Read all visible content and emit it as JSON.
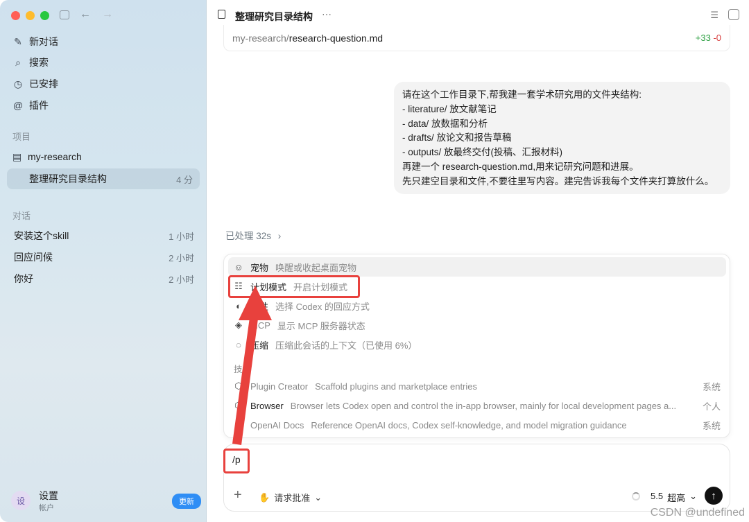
{
  "sidebar": {
    "top_icons": [
      "sidebar-toggle-icon",
      "back-arrow-icon",
      "forward-arrow-icon"
    ],
    "back_glyph": "←",
    "forward_glyph": "→",
    "nav": [
      {
        "icon": "compose-icon",
        "glyph": "✎",
        "label": "新对话"
      },
      {
        "icon": "search-icon",
        "glyph": "⌕",
        "label": "搜索"
      },
      {
        "icon": "clock-icon",
        "glyph": "◷",
        "label": "已安排"
      },
      {
        "icon": "plugin-icon",
        "glyph": "@",
        "label": "插件"
      }
    ],
    "projects_label": "项目",
    "project": {
      "icon": "folder-icon",
      "glyph": "▤",
      "label": "my-research"
    },
    "active_task": {
      "label": "整理研究目录结构",
      "meta": "4 分"
    },
    "conversations_label": "对话",
    "conversations": [
      {
        "label": "安装这个skill",
        "meta": "1 小时"
      },
      {
        "label": "回应问候",
        "meta": "2 小时"
      },
      {
        "label": "你好",
        "meta": "2 小时"
      }
    ],
    "user": {
      "avatar": "设",
      "name": "设置",
      "sub": "帐户",
      "update_label": "更新"
    }
  },
  "header": {
    "title": "整理研究目录结构",
    "more_glyph": "···",
    "list_glyph": "☰"
  },
  "file_card": {
    "dir": "my-research/",
    "file": "research-question.md",
    "added": "+33",
    "removed": "-0"
  },
  "message": {
    "lines": [
      "请在这个工作目录下,帮我建一套学术研究用的文件夹结构:",
      "- literature/ 放文献笔记",
      "- data/ 放数据和分析",
      "- drafts/ 放论文和报告草稿",
      "- outputs/ 放最终交付(投稿、汇报材料)",
      "再建一个 research-question.md,用来记研究问题和进展。",
      "先只建空目录和文件,不要往里写内容。建完告诉我每个文件夹打算放什么。"
    ]
  },
  "processed": {
    "label": "已处理 32s",
    "chevron": "›"
  },
  "commands": [
    {
      "icon": "pet-icon",
      "glyph": "☺",
      "name": "宠物",
      "desc": "唤醒或收起桌面宠物"
    },
    {
      "icon": "checklist-icon",
      "glyph": "☷",
      "name": "计划模式",
      "desc": "开启计划模式"
    },
    {
      "icon": "personality-icon",
      "glyph": "◐",
      "name": "个性",
      "desc": "选择 Codex 的回应方式"
    },
    {
      "icon": "mcp-icon",
      "glyph": "◈",
      "name": "MCP",
      "desc": "显示 MCP 服务器状态"
    },
    {
      "icon": "compress-icon",
      "glyph": "◌",
      "name": "压缩",
      "desc": "压缩此会话的上下文（已使用 6%）"
    }
  ],
  "skills_label": "技能",
  "skills": [
    {
      "icon": "cube-icon",
      "glyph": "⬡",
      "name": "Plugin Creator",
      "desc": "Scaffold plugins and marketplace entries",
      "scope": "系统"
    },
    {
      "icon": "cube-icon",
      "glyph": "⬡",
      "name": "Browser",
      "desc": "Browser lets Codex open and control the in-app browser, mainly for local development pages a...",
      "scope": "个人"
    },
    {
      "icon": "cube-icon",
      "glyph": "⬡",
      "name": "OpenAI Docs",
      "desc": "Reference OpenAI docs, Codex self-knowledge, and model migration guidance",
      "scope": "系统"
    }
  ],
  "composer": {
    "value": "/p",
    "plus_glyph": "+",
    "approval_glyph": "✋",
    "approval_label": "请求批准",
    "chevron": "⌄",
    "model": "5.5",
    "effort": "超高",
    "send_glyph": "↑"
  },
  "watermark": "CSDN @undefined",
  "colors": {
    "highlight": "#e8413d",
    "accent": "#2f8ef5",
    "diff_add": "#2ea043",
    "diff_del": "#d73a3a"
  }
}
